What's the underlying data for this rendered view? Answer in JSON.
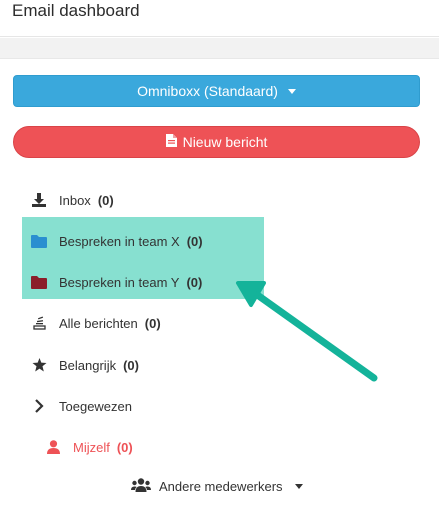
{
  "header": {
    "title": "Email dashboard"
  },
  "mailbox_button": {
    "label": "Omniboxx (Standaard)"
  },
  "new_message_button": {
    "label": "Nieuw bericht"
  },
  "nav": {
    "inbox": {
      "label": "Inbox",
      "count": "(0)",
      "icon": "download-icon",
      "color": "#333333"
    },
    "team_x": {
      "label": "Bespreken in team X",
      "count": "(0)",
      "icon": "folder-icon",
      "color": "#2a8fd0"
    },
    "team_y": {
      "label": "Bespreken in team Y",
      "count": "(0)",
      "icon": "folder-icon",
      "color": "#8b1e2a"
    },
    "all": {
      "label": "Alle berichten",
      "count": "(0)",
      "icon": "stack-icon",
      "color": "#333333"
    },
    "important": {
      "label": "Belangrijk",
      "count": "(0)",
      "icon": "star-icon",
      "color": "#333333"
    },
    "assigned": {
      "label": "Toegewezen",
      "icon": "chevron-right-icon",
      "color": "#333333"
    },
    "myself": {
      "label": "Mijzelf",
      "count": "(0)",
      "icon": "user-icon",
      "color": "#ee5256"
    }
  },
  "others": {
    "label": "Andere medewerkers",
    "icon": "users-icon"
  },
  "colors": {
    "primary": "#3aa8dc",
    "danger": "#ee5256",
    "highlight": "#87e0d0",
    "arrow": "#14b39a"
  }
}
